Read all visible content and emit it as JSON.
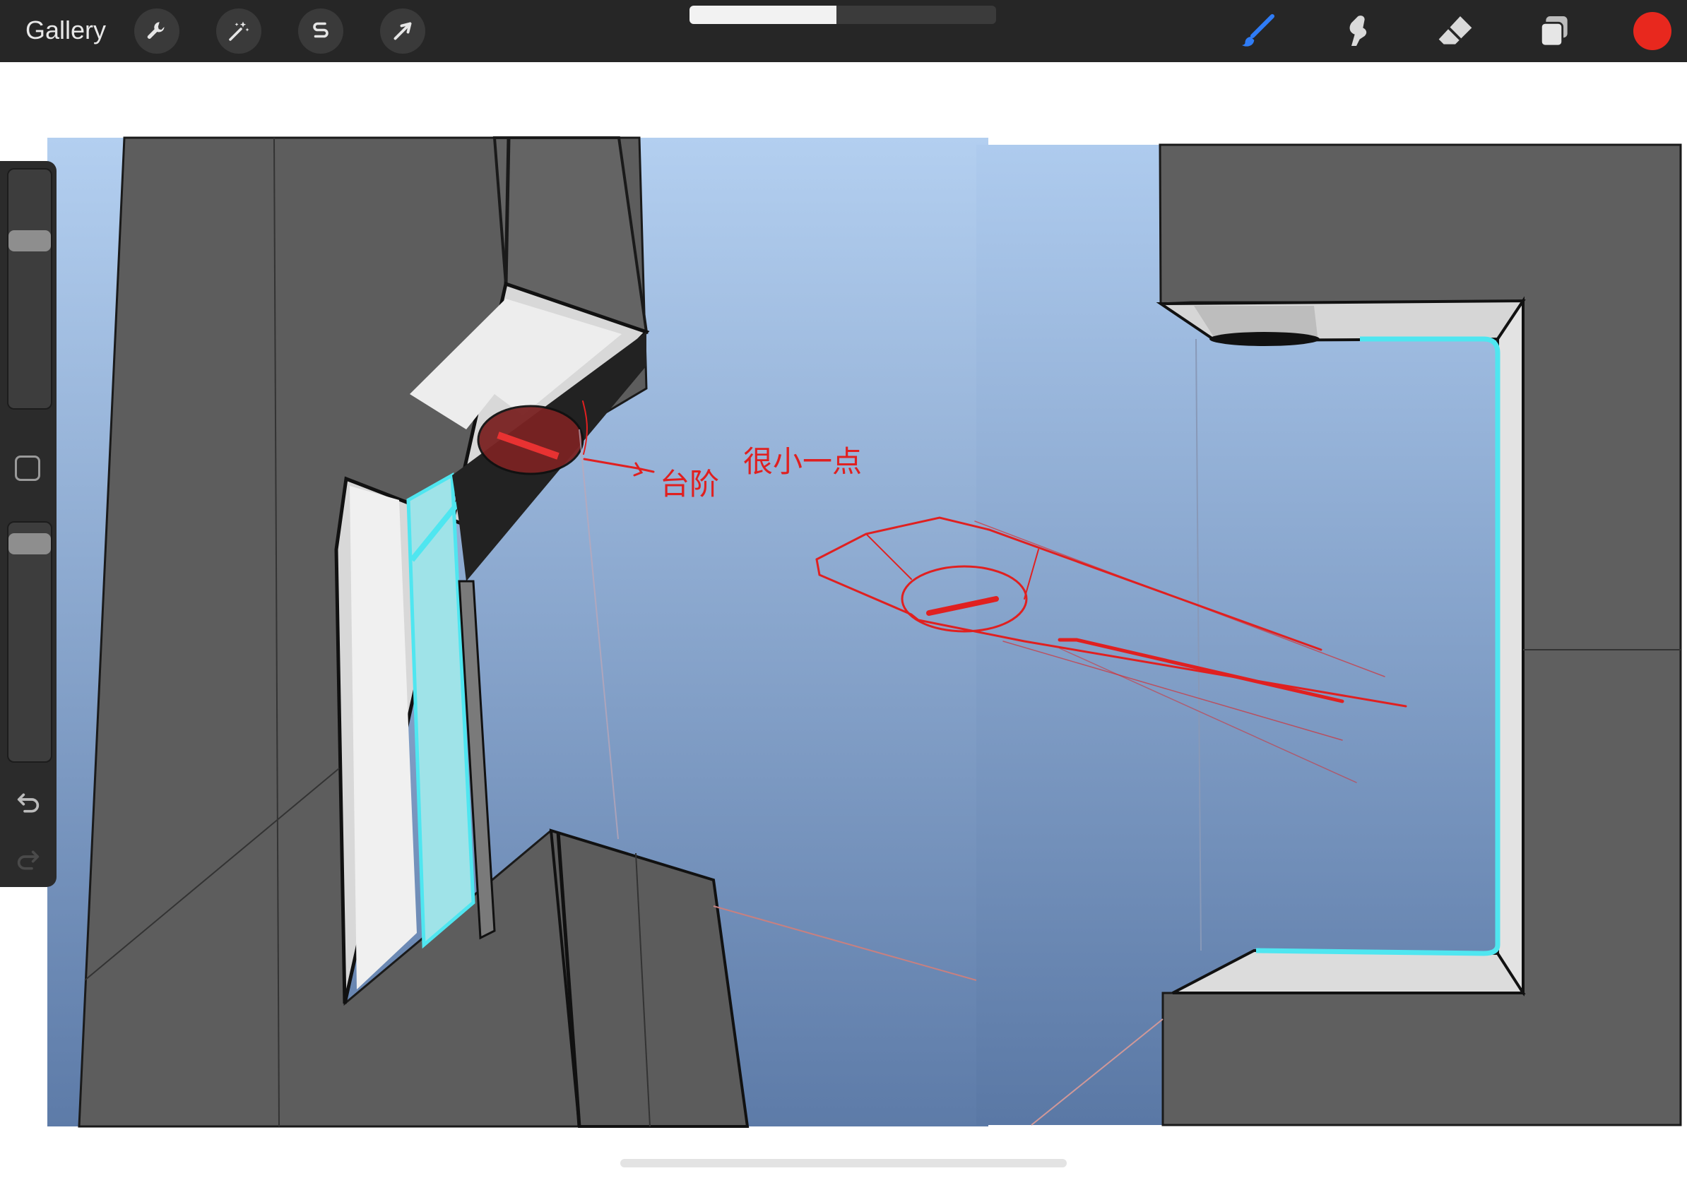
{
  "topbar": {
    "gallery_label": "Gallery",
    "left_tools": [
      {
        "name": "actions",
        "icon": "wrench-icon"
      },
      {
        "name": "adjustments",
        "icon": "magic-wand-icon"
      },
      {
        "name": "selection",
        "icon": "selection-s-icon"
      },
      {
        "name": "transform",
        "icon": "arrow-cursor-icon"
      }
    ],
    "status_progress": 0.48,
    "right_tools": [
      {
        "name": "brush",
        "icon": "brush-icon",
        "active": true
      },
      {
        "name": "smudge",
        "icon": "smudge-finger-icon",
        "active": false
      },
      {
        "name": "eraser",
        "icon": "eraser-icon",
        "active": false
      },
      {
        "name": "layers",
        "icon": "layers-icon",
        "active": false
      }
    ],
    "current_color": "#e8281e"
  },
  "sidebar": {
    "brush_size_level": 0.72,
    "opacity_level": 0.95,
    "undo_icon": "undo-arrow-icon",
    "redo_icon": "redo-arrow-icon",
    "modify_icon": "square-modify-icon"
  },
  "canvas": {
    "annotation_arrow_text": "台阶",
    "annotation_note_text": "很小一点",
    "accent_colors": {
      "sky_top": "#b3cff0",
      "sky_bottom": "#5d7ba8",
      "panel_gray": "#5f5f5f",
      "cyan_led": "#4fe6f0",
      "sketch_red": "#e02020"
    }
  }
}
